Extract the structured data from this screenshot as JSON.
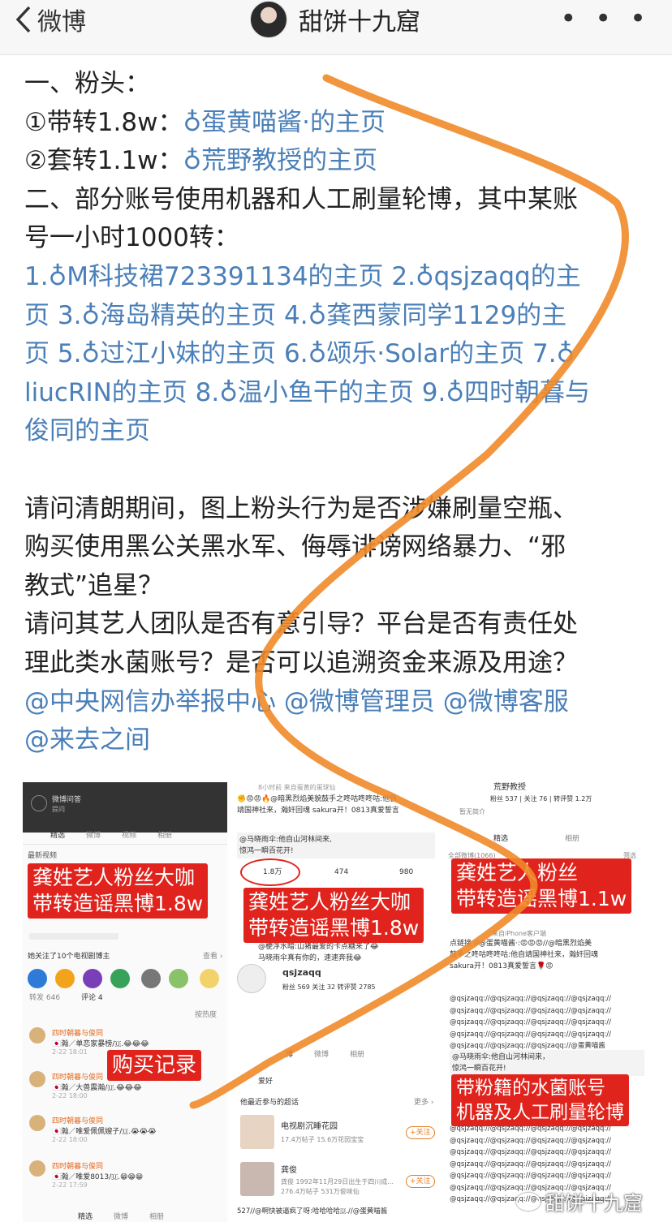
{
  "header": {
    "back_label": "微博",
    "title": "甜饼十九窟",
    "more_label": "• • •"
  },
  "post": {
    "section1": "一、粉头：",
    "item1_prefix": "①带转1.8w：",
    "item1_link": "蛋黄喵酱·的主页",
    "item2_prefix": "②套转1.1w：",
    "item2_link": "荒野教授的主页",
    "section2_line1": "二、部分账号使用机器和人工刷量轮博，其中某账",
    "section2_line2": "号一小时1000转：",
    "accounts_line1": "1.♁M科技裙723391134的主页 2.♁qsjzaqq的主",
    "accounts_line2": "页 3.♁海岛精英的主页 4.♁龚西蒙同学1129的主",
    "accounts_line3": "页 5.♁过江小妹的主页 6.♁颂乐·Solar的主页 7.♁",
    "accounts_line4": "liucRIN的主页 8.♁温小鱼干的主页 9.♁四时朝暮与",
    "accounts_line5": "俊同的主页",
    "question1_line1": "请问清朗期间，图上粉头行为是否涉嫌刷量空瓶、",
    "question1_line2": "购买使用黑公关黑水军、侮辱诽谤网络暴力、“邪",
    "question1_line3": "教式”追星？",
    "question2_line1": "请问其艺人团队是否有意引导？平台是否有责任处",
    "question2_line2": "理此类水菌账号？是否可以追溯资金来源及用途？",
    "mentions_line1": "@中央网信办举报中心 @微博管理员 @微博客服",
    "mentions_line2": "@来去之间"
  },
  "collage": {
    "shot1": {
      "top_title": "微博问答",
      "top_sub": "提问",
      "tabs": [
        "精选",
        "微博",
        "视频",
        "相册"
      ],
      "recent_video": "最新视频",
      "follow_text": "她关注了10个电视剧博主",
      "view_all": "查看 ›",
      "comment_tabs": [
        "转发 646",
        "评论 4"
      ],
      "sort_label": "按热度",
      "comments": [
        {
          "name": "四时朝暮与俊同",
          "text": "🇯🇵瀚／单恋家暴榜/🇺.😂😂😂",
          "date": "2-22 18:01"
        },
        {
          "name": "四时朝暮与俊同",
          "text": "🇯🇵瀚／大兽震瀚/🇺.😂😂😂",
          "date": "2-22 18:00"
        },
        {
          "name": "四时朝暮与俊同",
          "text": "🇯🇵瀚／唯爱佩佩嫂子/🇺.😭😭😭",
          "date": "2-22 18:00"
        },
        {
          "name": "四时朝暮与俊同",
          "text": "🇯🇵瀚／唯爱8013/🇺.😁😁😁",
          "date": "2-22 17:59"
        }
      ],
      "bottom_tabs": [
        "精选",
        "微博",
        "相册"
      ],
      "label_top": "龚姓艺人粉丝大咖\n带转造谣黑博1.8w",
      "label_buy": "购买记录"
    },
    "shot2": {
      "meta": "8小时前 来自蛋黄的蛋球仙",
      "quote": "✊😡😡🔥@暗黑烈焰美貌鼓手之咚咕咚咚咕:他自\n靖国神社来，瀚奸回魂 sakura开！0813真爱誓言",
      "quote2": "@马晓雨伞:他自山河林间来,\n惊鸿一瞬百花开!",
      "repost_count": "1.8万",
      "comment_count": "474",
      "like_count": "980",
      "sub_quote": "@梗浮水暗:山猪最爱的卡点糖来了😂\n马晓雨伞真有你的，速速奔我😂",
      "account_name": "qsjzaqq",
      "account_stats": "粉丝 569  关注 32  转评赞 2785",
      "tabs": [
        "博",
        "微博",
        "相册"
      ],
      "interests": "爱好",
      "super_topics": "他最近参与的超话",
      "more": "更多 ›",
      "topic1": "电视剧沉睡花园",
      "topic1_sub": "17.4万帖子 15.6万花园宝宝",
      "topic2": "龚俊",
      "topic2_sub": "龚俊 1992年11月29日出生于四川成...",
      "topic2_sub2": "276.4万帖子 531万俊味仙",
      "follow_btn": "+关注",
      "bottom_quote": "527//@啊快被逼疯了呀:哈哈哈哈🇺.//@蛋黄喵酱",
      "label": "龚姓艺人粉丝大咖\n带转造谣黑博1.8w"
    },
    "shot3": {
      "name": "荒野教授",
      "stats": "粉丝 537 | 关注 76 | 转评赞 1.2万",
      "intro": "暂无简介",
      "tabs": [
        "精选",
        "相册"
      ],
      "all_weibo": "全部微博(1066)",
      "filter": "筛选",
      "label_top": "龚姓艺人粉丝\n带转造谣黑博1.1w",
      "client": "来自iPhone客户端",
      "repost_text": "点链接 //@蛋黄喵酱·:😡😡😡//@暗黑烈焰美\n鼓手之咚咕咚咚咕:他自靖国神社来，瀚奸回魂\nsakura开！0813真爱誓言🌹😡",
      "qs_lines": "@qsjzaqq://@qsjzaqq://@qsjzaqq://@qsjzaqq://",
      "qs_last": "@qsjzaqq://@qsjzaqq://@qsjzaqq://@蛋黄喵酱",
      "quote": "@马晓雨伞:他自山河林间来，\n惊鸿一瞬百花开!",
      "label_bottom": "带粉籍的水菌账号\n机器及人工刷量轮博",
      "watermark": "甜饼十九窟"
    }
  }
}
